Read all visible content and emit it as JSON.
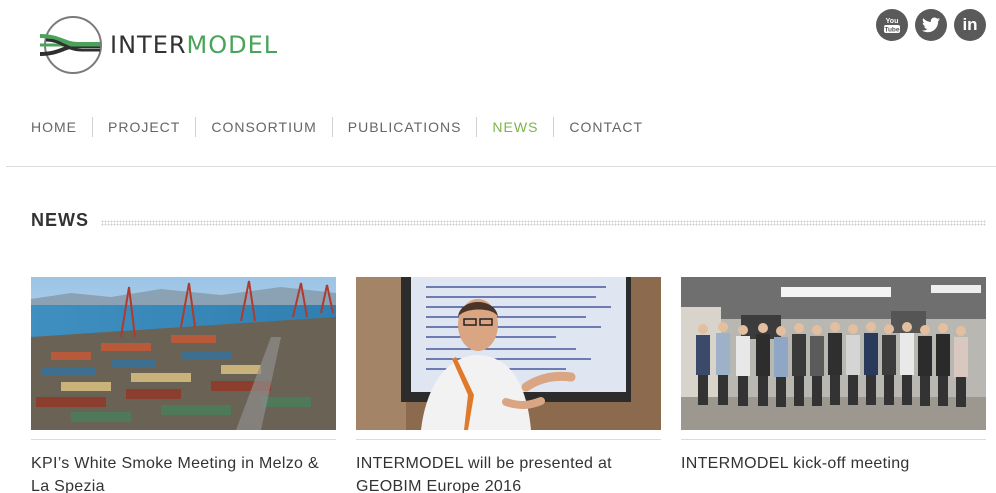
{
  "brand": {
    "name_part1": "INTER",
    "name_part2": "MODEL",
    "accent_color": "#4aa35a"
  },
  "social": [
    {
      "icon": "youtube-icon",
      "label": "You Tube"
    },
    {
      "icon": "twitter-icon",
      "label": ""
    },
    {
      "icon": "linkedin-icon",
      "label": "in"
    }
  ],
  "nav": {
    "items": [
      {
        "label": "HOME"
      },
      {
        "label": "PROJECT"
      },
      {
        "label": "CONSORTIUM"
      },
      {
        "label": "PUBLICATIONS"
      },
      {
        "label": "NEWS",
        "active": true
      },
      {
        "label": "CONTACT"
      }
    ],
    "active_color": "#7ab648"
  },
  "news": {
    "section_title": "NEWS",
    "items": [
      {
        "title": "KPI’s White Smoke Meeting in Melzo & La Spezia"
      },
      {
        "title": "INTERMODEL will be presented at GEOBIM Europe 2016"
      },
      {
        "title": "INTERMODEL kick-off meeting"
      }
    ]
  }
}
